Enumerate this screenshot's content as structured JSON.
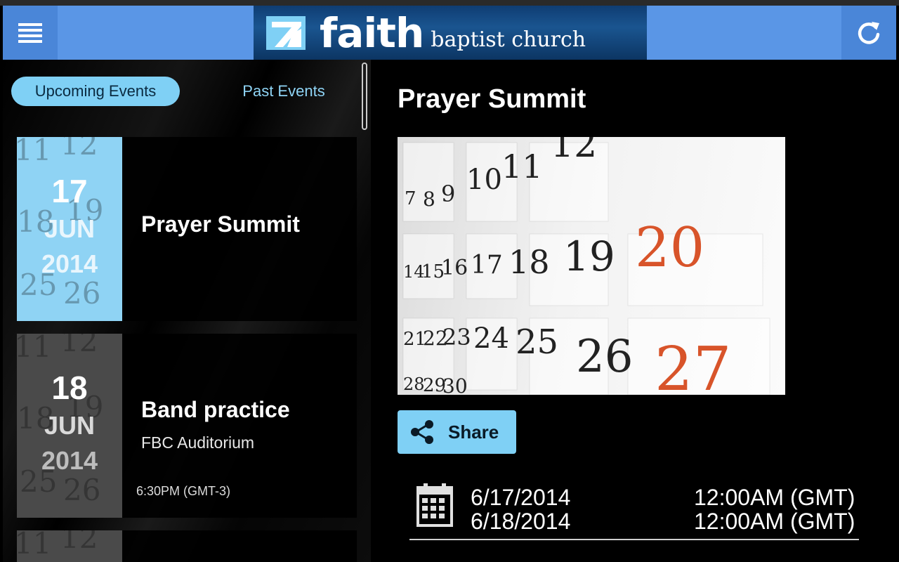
{
  "header": {
    "logo_word": "faith",
    "logo_sub": "baptist church"
  },
  "tabs": {
    "upcoming": "Upcoming Events",
    "past": "Past Events"
  },
  "events": [
    {
      "day": "17",
      "month": "JUN",
      "year": "2014",
      "title": "Prayer Summit",
      "location": "",
      "time": ""
    },
    {
      "day": "18",
      "month": "JUN",
      "year": "2014",
      "title": "Band practice",
      "location": "FBC Auditorium",
      "time": "6:30PM (GMT-3)"
    }
  ],
  "detail": {
    "title": "Prayer Summit",
    "share_label": "Share",
    "start_date": "6/17/2014",
    "start_time": "12:00AM (GMT)",
    "end_date": "6/18/2014",
    "end_time": "12:00AM (GMT)"
  },
  "calendar_photo_numbers": [
    "7",
    "8",
    "9",
    "10",
    "11",
    "12",
    "14",
    "15",
    "16",
    "17",
    "18",
    "19",
    "20",
    "21",
    "22",
    "23",
    "24",
    "25",
    "26",
    "27",
    "28",
    "29",
    "30"
  ],
  "colors": {
    "header_blue": "#5a96e6",
    "accent_cyan": "#7fd0f5",
    "logo_navy": "#1a5590",
    "calendar_red": "#d8542a"
  },
  "icons": {
    "menu": "hamburger-icon",
    "refresh": "refresh-icon",
    "share": "share-icon",
    "calendar": "calendar-icon"
  }
}
